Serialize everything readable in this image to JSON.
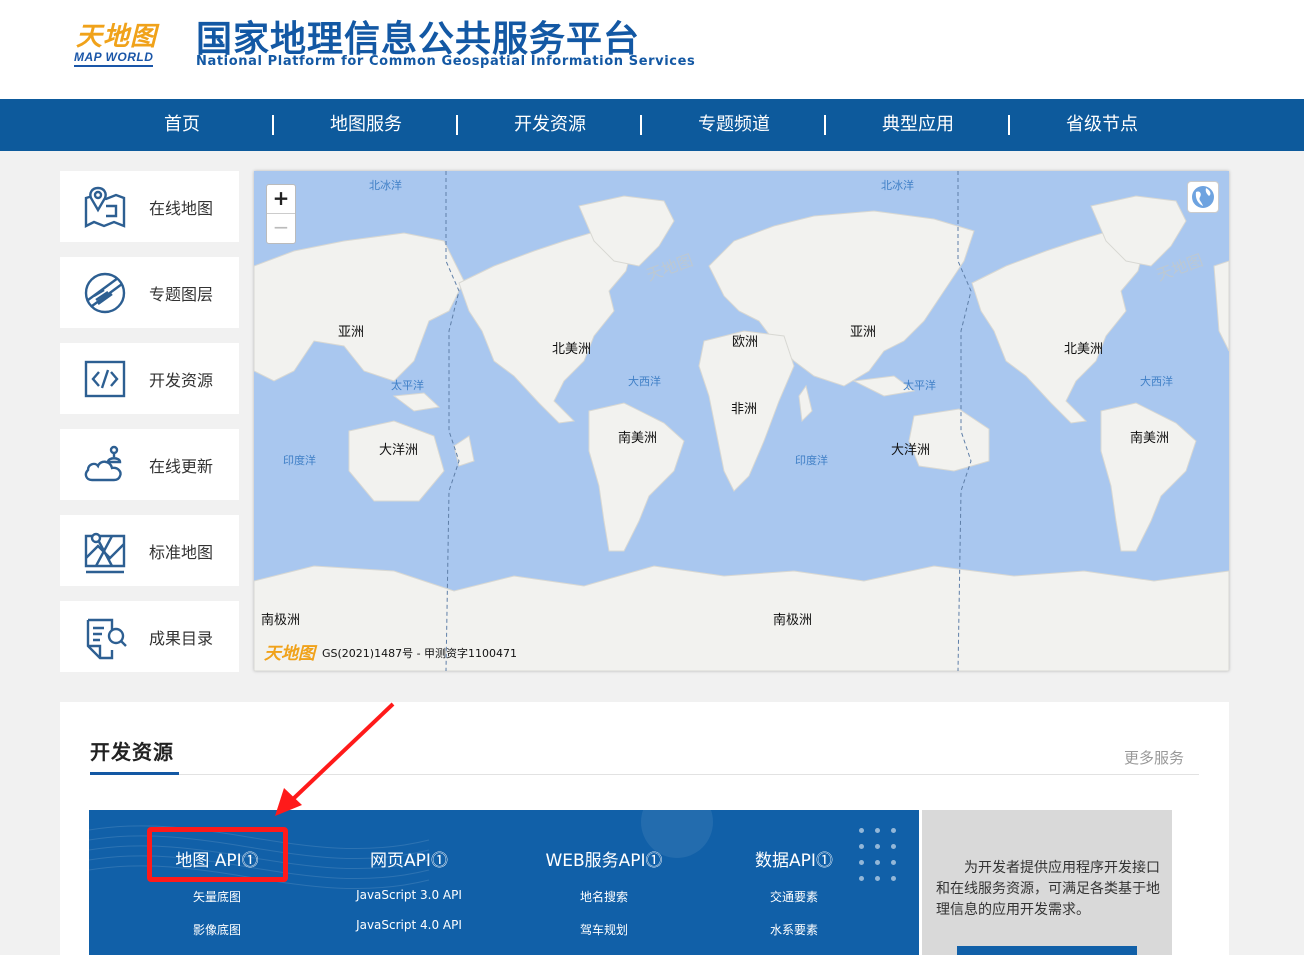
{
  "header": {
    "logo_cn": "天地图",
    "logo_en": "MAP WORLD",
    "title": "国家地理信息公共服务平台",
    "subtitle": "National Platform for Common Geospatial Information Services"
  },
  "nav": {
    "items": [
      "首页",
      "地图服务",
      "开发资源",
      "专题频道",
      "典型应用",
      "省级节点"
    ]
  },
  "sidebar": {
    "items": [
      {
        "label": "在线地图",
        "icon": "map-pin-icon"
      },
      {
        "label": "专题图层",
        "icon": "layers-icon"
      },
      {
        "label": "开发资源",
        "icon": "code-icon"
      },
      {
        "label": "在线更新",
        "icon": "cloud-update-icon"
      },
      {
        "label": "标准地图",
        "icon": "standard-map-icon"
      },
      {
        "label": "成果目录",
        "icon": "catalog-search-icon"
      }
    ]
  },
  "map": {
    "zoom_in": "+",
    "zoom_out": "−",
    "continents": [
      "北冰洋",
      "北冰洋",
      "亚洲",
      "北美洲",
      "欧洲",
      "亚洲",
      "北美洲",
      "太平洋",
      "大西洋",
      "太平洋",
      "大西洋",
      "非洲",
      "南美洲",
      "南美洲",
      "大洋洲",
      "大洋洲",
      "印度洋",
      "印度洋",
      "南极洲",
      "南极洲"
    ],
    "credit_logo": "天地图",
    "credit": "GS(2021)1487号 - 甲测资字1100471"
  },
  "dev": {
    "title": "开发资源",
    "more": "更多服务",
    "columns": [
      {
        "head": "地图 API⓵",
        "items": [
          "矢量底图",
          "影像底图"
        ]
      },
      {
        "head": "网页API⓵",
        "items": [
          "JavaScript 3.0 API",
          "JavaScript 4.0 API"
        ]
      },
      {
        "head": "WEB服务API⓵",
        "items": [
          "地名搜索",
          "驾车规划"
        ]
      },
      {
        "head": "数据API⓵",
        "items": [
          "交通要素",
          "水系要素"
        ]
      }
    ],
    "description": "为开发者提供应用程序开发接口和在线服务资源，可满足各类基于地理信息的应用开发需求。"
  },
  "colors": {
    "brand_blue": "#1358a4",
    "nav_blue": "#0d5a9c",
    "panel_blue": "#1160a8",
    "ocean": "#a9c7ef",
    "land": "#f2f2ef",
    "annotation_red": "#ff1a1a"
  }
}
